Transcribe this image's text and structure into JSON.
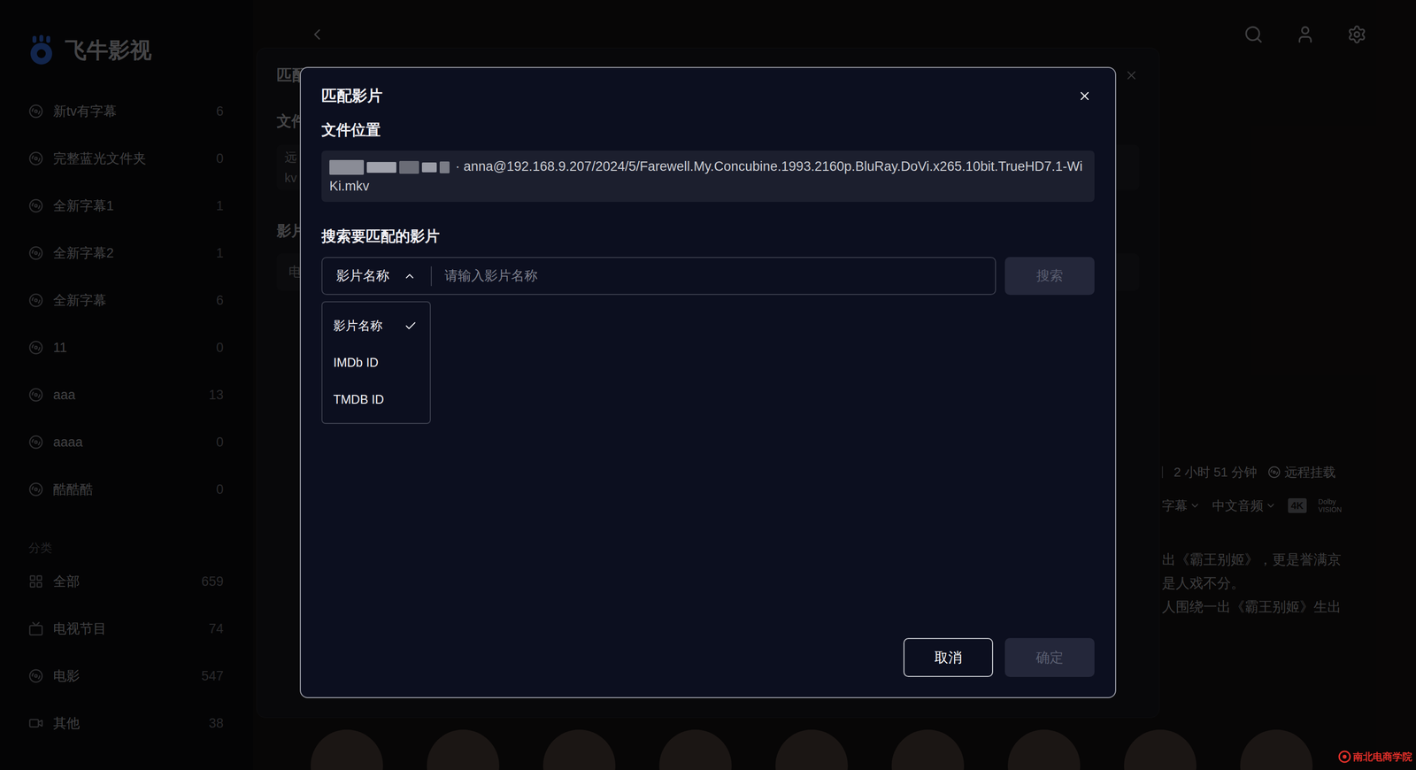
{
  "app": {
    "logo": "飞牛影视"
  },
  "sidebar": {
    "libraries": [
      {
        "label": "新tv有字幕",
        "count": "6"
      },
      {
        "label": "完整蓝光文件夹",
        "count": "0"
      },
      {
        "label": "全新字幕1",
        "count": "1"
      },
      {
        "label": "全新字幕2",
        "count": "1"
      },
      {
        "label": "全新字幕",
        "count": "6"
      },
      {
        "label": "11",
        "count": "0"
      },
      {
        "label": "aaa",
        "count": "13"
      },
      {
        "label": "aaaa",
        "count": "0"
      },
      {
        "label": "酷酷酷",
        "count": "0"
      }
    ],
    "section": "分类",
    "categories": [
      {
        "label": "全部",
        "count": "659",
        "kind": "all"
      },
      {
        "label": "电视节目",
        "count": "74",
        "kind": "tv"
      },
      {
        "label": "电影",
        "count": "547",
        "kind": "movie"
      },
      {
        "label": "其他",
        "count": "38",
        "kind": "other"
      }
    ]
  },
  "detail": {
    "duration": "2 小时 51 分钟",
    "mount": "远程挂载",
    "subtitle": "字幕",
    "audio": "中文音频",
    "badge": "4K",
    "dolby": "Dolby VISION",
    "description": [
      "出《霸王别姬》，更是誉满京",
      "是人戏不分。",
      "人围绕一出《霸王别姬》生出"
    ]
  },
  "watermark": "南北电商学院",
  "back_dialog": {
    "title": "匹配",
    "file_label": "文件",
    "file_lines": [
      "远",
      "kv"
    ],
    "movie_label": "影片",
    "movie_value": "电"
  },
  "dialog": {
    "title": "匹配影片",
    "file_section": "文件位置",
    "file_path": "· anna@192.168.9.207/2024/5/Farewell.My.Concubine.1993.2160p.BluRay.DoVi.x265.10bit.TrueHD7.1-WiKi.mkv",
    "search_section": "搜索要匹配的影片",
    "search_type": "影片名称",
    "search_type_open": true,
    "placeholder": "请输入影片名称",
    "search_button": {
      "label": "搜索",
      "disabled": true
    },
    "search_types": [
      {
        "label": "影片名称",
        "selected": true
      },
      {
        "label": "IMDb ID",
        "selected": false
      },
      {
        "label": "TMDB ID",
        "selected": false
      }
    ],
    "buttons": [
      {
        "label": "取消",
        "disabled": false
      },
      {
        "label": "确定",
        "disabled": true
      }
    ]
  }
}
